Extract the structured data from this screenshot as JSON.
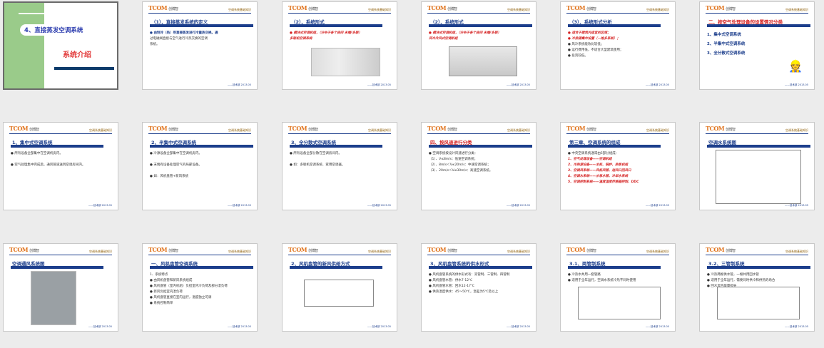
{
  "logo": {
    "brand": "TCOM",
    "brand_cn": "创博智",
    "header_right": "空调系统基础知识",
    "footer": "——技术部  2013.05"
  },
  "slides": [
    {
      "kind": "cover",
      "title": "4、直接蒸发空调系统",
      "subtitle": "系统介绍"
    },
    {
      "title": "（1）、直接蒸发系统的定义",
      "lines": [
        "● 由制冷（热）剂直接蒸发进行冷量热交换。通",
        "过电磁阀直接与空气进行冷热交换的空调",
        "系统。"
      ]
    },
    {
      "title": "（2）、系统形式",
      "lines": [
        "● 模块式空调机组，（分布于各个房间 末端/多联）",
        "多联机空调系统"
      ],
      "figure": "hvac"
    },
    {
      "title": "（2）、系统形式",
      "lines": [
        "● 模块式空调机组，（分布于各个房间 末端/多联）",
        "风冷冷风式空调机组"
      ],
      "figure": "unit"
    },
    {
      "title": "（3）、系统形式分析",
      "lines": [
        "● 适合于建筑内适宜的区域；",
        "● 冷热源集中设置（一拖多系统）；",
        "● 风冷系统能效比较低；",
        "● 运行费用低，不适合大型建筑使用；",
        "● 投资较低。"
      ]
    },
    {
      "title": "二、按空气处理设备的设置情况分类",
      "title_red": true,
      "big": [
        "1、集中式空调系统",
        "2、半集中式空调系统",
        "3、全分散式空调系统"
      ]
    },
    {
      "title": "1、集中式空调系统",
      "lines": [
        "● 所有设备全部集中在空调机房内。",
        "",
        "● 空气处理集中完成后，通风管道送到空调房间内。"
      ]
    },
    {
      "title": "2、半集中式空调系统",
      "lines": [
        "● 冷源设备全部集中在空调机房内。",
        "",
        "● 末端有设备处理空气的局部设备。",
        "",
        "● 如：风机盘管+新风系统"
      ]
    },
    {
      "title": "3、全分散式空调系统",
      "lines": [
        "● 所有设备全部分散在空调房间内。",
        "",
        "● 如：多联机空调系统、家用空调器。"
      ]
    },
    {
      "title": "四、按风速进行分类",
      "title_red": true,
      "lines": [
        "● 空调系统按设计风速进行分类：",
        "（1）、V≤8m/s：低速空调系统；",
        "（2）、8m/s＜V≤20m/s：中速空调系统；",
        "（3）、20m/s＜V≤30m/s：高速空调系统。"
      ]
    },
    {
      "title": "第三章、空调系统的组成",
      "lines": [
        "● 中央空调系统通常由5部分组成：",
        "1、空气处理设备——空调机组",
        "2、冷热源设备——主机、锅炉、热泵机组",
        "3、空调风系统——风机风管、送风口回风口",
        "4、空调水系统——水泵水管、冷却水系统",
        "5、空调控制系统——温度湿度传感器控制、DDC"
      ]
    },
    {
      "title": "空调水系统图",
      "figure": "schem"
    },
    {
      "title": "空调通风系统图",
      "figure": "plan"
    },
    {
      "title": "一、风机盘管空调系统",
      "lines": [
        "1、系统特点",
        "● 由风机盘管和新风系统组成",
        "● 风机盘管（室内机组）负担室内冷负荷及部分湿负荷",
        "● 新风负担室内湿负荷",
        "● 风机盘管直接在室内运行，温度独立可调",
        "● 系统控制简单"
      ]
    },
    {
      "title": "2、风机盘管的新风供给方式",
      "figure": "schem"
    },
    {
      "title": "3、风机盘管系统的供水形式",
      "lines": [
        "● 风机盘管系统的供水形式有：双管制、三管制、四管制",
        "● 风机盘管水管：供水7-12℃",
        "● 风机盘管水管：回水12-17℃",
        "● 供热温度供水：45～50℃，温差为5℃及以上"
      ]
    },
    {
      "title": "3.1、两管制系统",
      "lines": [
        "● 冷热水共用一套管路",
        "● 适用于全年运行，空调水系统冷热不同时使用"
      ],
      "figure": "schem"
    },
    {
      "title": "3.2、三管制系统",
      "lines": [
        "● 冷热两根供水管，一根共用回水管",
        "● 适用于全年运行，需要同时供冷和供热的场合",
        "● 回水混合能量损失"
      ],
      "figure": "schem"
    }
  ]
}
